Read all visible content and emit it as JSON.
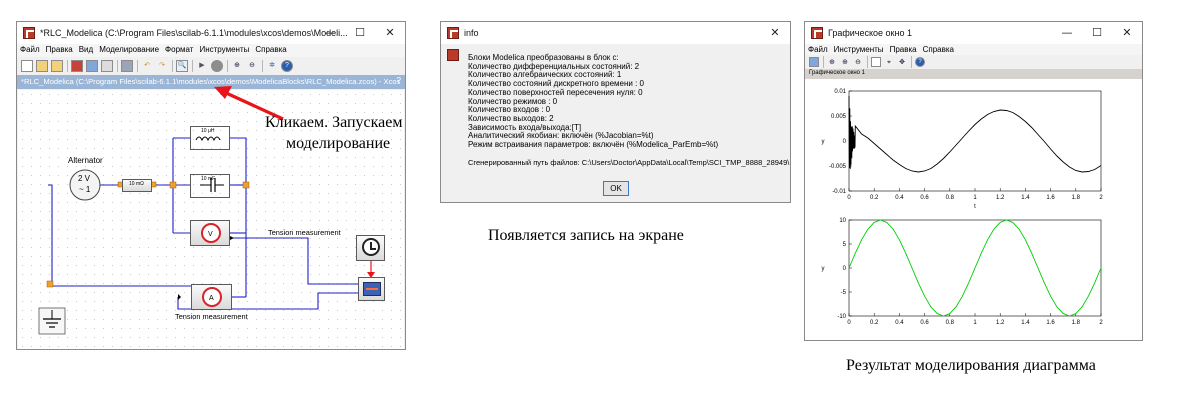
{
  "xcos": {
    "title": "*RLC_Modelica (C:\\Program Files\\scilab-6.1.1\\modules\\xcos\\demos\\Modeli...",
    "window_buttons": [
      "—",
      "☐",
      "✕"
    ],
    "menu": [
      "Файл",
      "Правка",
      "Вид",
      "Моделирование",
      "Формат",
      "Инструменты",
      "Справка"
    ],
    "tab_title": "*RLC_Modelica (C:\\Program Files\\scilab-6.1.1\\modules\\xcos\\demos\\ModelicaBlocks\\RLC_Modelica.zcos) - Xcos",
    "tab_help": "?",
    "diagram": {
      "alternator_label": "Alternator",
      "source_line1": "2 V",
      "source_line2": "~ 1",
      "resistor_label": "10 mΩ",
      "inductor_label": "10 μH",
      "capacitor_label": "10 mF",
      "voltmeter_label": "V",
      "ammeter_label": "A",
      "tension_label_1": "Tension measurement",
      "tension_label_2": "Tension measurement"
    }
  },
  "annotation_click": {
    "line1": "Кликаем. Запускаем",
    "line2": "моделирование"
  },
  "info": {
    "title": "info",
    "close": "✕",
    "lines": [
      "Блоки Modelica преобразованы в блок с:",
      "Количество дифференциальных состояний: 2",
      "Количество алгебраических состояний: 1",
      "Количество состояний дискретного времени : 0",
      "Количество поверхностей пересечения нуля: 0",
      "Количество режимов : 0",
      "Количество входов : 0",
      "Количество выходов: 2",
      "Зависимость входа/выхода:[T]",
      "Аналитический якобиан: включён (%Jacobian=%t)",
      "Режим встраивания параметров: включён (%Modelica_ParEmb=%t)"
    ],
    "path_line": "Сгенерированный путь файлов: C:\\Users\\Doctor\\AppData\\Local\\Temp\\SCI_TMP_8888_28949\\",
    "ok": "OK"
  },
  "annotation_info": "Появляется запись на экране",
  "graph": {
    "title": "Графическое окно 1",
    "window_buttons": [
      "—",
      "☐",
      "✕"
    ],
    "menu": [
      "Файл",
      "Инструменты",
      "Правка",
      "Справка"
    ],
    "subtitle": "Графическое окно 1"
  },
  "annotation_result": "Результат моделирования диаграмма",
  "colors": {
    "plot1_line": "#000000",
    "plot2_line": "#00cc00",
    "wire": "#1f1fc8",
    "annotation_arrow": "#e8141a",
    "port": "#f0a02a",
    "tab_header": "#9ab5d6"
  },
  "chart_data": [
    {
      "type": "line",
      "title": "",
      "xlabel": "t",
      "ylabel": "y",
      "xlim": [
        0,
        2
      ],
      "ylim": [
        -0.01,
        0.01
      ],
      "x_ticks": [
        0,
        0.2,
        0.4,
        0.6,
        0.8,
        1,
        1.2,
        1.4,
        1.6,
        1.8,
        2
      ],
      "x_tick_labels": [
        "0",
        "0.2",
        "0.4",
        "0.6",
        "0.8",
        "1",
        "1.2",
        "1.4",
        "1.6",
        "1.8",
        "2"
      ],
      "y_ticks": [
        -0.01,
        -0.005,
        0,
        0.005,
        0.01
      ],
      "y_tick_labels": [
        "-0.01",
        "-0.005",
        "0",
        "0.005",
        "0.01"
      ],
      "series": [
        {
          "color": "#000000",
          "values_description": "x in 0..2, y ≈ 0.006·sin(2πt − 0.45) with damped high-frequency oscillation near t=0",
          "x": [
            0,
            0.05,
            0.1,
            0.15,
            0.2,
            0.25,
            0.3,
            0.35,
            0.4,
            0.45,
            0.5,
            0.55,
            0.6,
            0.65,
            0.7,
            0.75,
            0.8,
            0.85,
            0.9,
            0.95,
            1,
            1.05,
            1.1,
            1.15,
            1.2,
            1.25,
            1.3,
            1.35,
            1.4,
            1.45,
            1.5,
            1.55,
            1.6,
            1.65,
            1.7,
            1.75,
            1.8,
            1.85,
            1.9,
            1.95,
            2
          ],
          "y": [
            0.009,
            0.003,
            0.0014,
            0.0006,
            -0.0005,
            -0.0016,
            -0.0027,
            -0.0038,
            -0.0047,
            -0.0055,
            -0.006,
            -0.0062,
            -0.006,
            -0.0055,
            -0.0046,
            -0.0035,
            -0.0022,
            -0.0008,
            0.0006,
            0.002,
            0.0033,
            0.0044,
            0.0053,
            0.0059,
            0.0062,
            0.0061,
            0.0057,
            0.0049,
            0.0039,
            0.0027,
            0.0013,
            -0.0001,
            -0.0016,
            -0.003,
            -0.0042,
            -0.0052,
            -0.0059,
            -0.0062,
            -0.0061,
            -0.0057,
            -0.0049
          ]
        }
      ]
    },
    {
      "type": "line",
      "title": "",
      "xlabel": "",
      "ylabel": "y",
      "xlim": [
        0,
        2
      ],
      "ylim": [
        -10,
        10
      ],
      "x_ticks": [
        0,
        0.2,
        0.4,
        0.6,
        0.8,
        1,
        1.2,
        1.4,
        1.6,
        1.8,
        2
      ],
      "x_tick_labels": [
        "0",
        "0.2",
        "0.4",
        "0.6",
        "0.8",
        "1",
        "1.2",
        "1.4",
        "1.6",
        "1.8",
        "2"
      ],
      "y_ticks": [
        -10,
        -5,
        0,
        5,
        10
      ],
      "y_tick_labels": [
        "-10",
        "-5",
        "0",
        "5",
        "10"
      ],
      "series": [
        {
          "color": "#00cc00",
          "x": [
            0,
            0.05,
            0.1,
            0.15,
            0.2,
            0.25,
            0.3,
            0.35,
            0.4,
            0.45,
            0.5,
            0.55,
            0.6,
            0.65,
            0.7,
            0.75,
            0.8,
            0.85,
            0.9,
            0.95,
            1,
            1.05,
            1.1,
            1.15,
            1.2,
            1.25,
            1.3,
            1.35,
            1.4,
            1.45,
            1.5,
            1.55,
            1.6,
            1.65,
            1.7,
            1.75,
            1.8,
            1.85,
            1.9,
            1.95,
            2
          ],
          "y": [
            0,
            3.09,
            5.88,
            8.09,
            9.51,
            10,
            9.51,
            8.09,
            5.88,
            3.09,
            0,
            -3.09,
            -5.88,
            -8.09,
            -9.51,
            -10,
            -9.51,
            -8.09,
            -5.88,
            -3.09,
            0,
            3.09,
            5.88,
            8.09,
            9.51,
            10,
            9.51,
            8.09,
            5.88,
            3.09,
            0,
            -3.09,
            -5.88,
            -8.09,
            -9.51,
            -10,
            -9.51,
            -8.09,
            -5.88,
            -3.09,
            0
          ]
        }
      ]
    }
  ]
}
